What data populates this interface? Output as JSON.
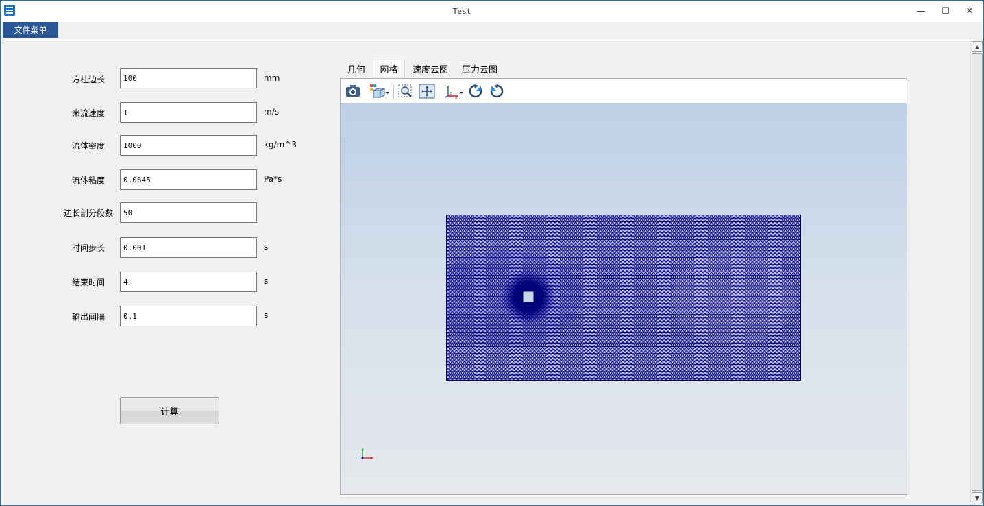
{
  "window": {
    "title": "Test",
    "minimize_glyph": "—",
    "maximize_glyph": "☐",
    "close_glyph": "✕"
  },
  "menu": {
    "file_menu_label": "文件菜单"
  },
  "form": {
    "fields": [
      {
        "label": "方柱边长",
        "value": "100",
        "unit": "mm"
      },
      {
        "label": "来流速度",
        "value": "1",
        "unit": "m/s"
      },
      {
        "label": "流体密度",
        "value": "1000",
        "unit": "kg/m^3"
      },
      {
        "label": "流体粘度",
        "value": "0.0645",
        "unit": "Pa*s"
      },
      {
        "label": "边长剖分段数",
        "value": "50",
        "unit": ""
      },
      {
        "label": "时间步长",
        "value": "0.001",
        "unit": "s"
      },
      {
        "label": "结束时间",
        "value": "4",
        "unit": "s"
      },
      {
        "label": "输出间隔",
        "value": "0.1",
        "unit": "s"
      }
    ],
    "calc_button_label": "计算"
  },
  "tabs": [
    {
      "label": "几何",
      "active": false
    },
    {
      "label": "网格",
      "active": true
    },
    {
      "label": "速度云图",
      "active": false
    },
    {
      "label": "压力云图",
      "active": false
    }
  ],
  "toolbar": {
    "icons": [
      "camera-icon",
      "view-cube-icon",
      "zoom-box-icon",
      "fit-view-icon",
      "axes-orient-icon",
      "rotate-ccw-icon",
      "rotate-cw-icon"
    ]
  },
  "viewer": {
    "mesh_color": "#00008b",
    "background_top": "#bcd0e5",
    "background_bottom": "#e6e8ec"
  },
  "colors": {
    "menu_accent": "#2b5797",
    "window_border": "#1f6fb5"
  }
}
